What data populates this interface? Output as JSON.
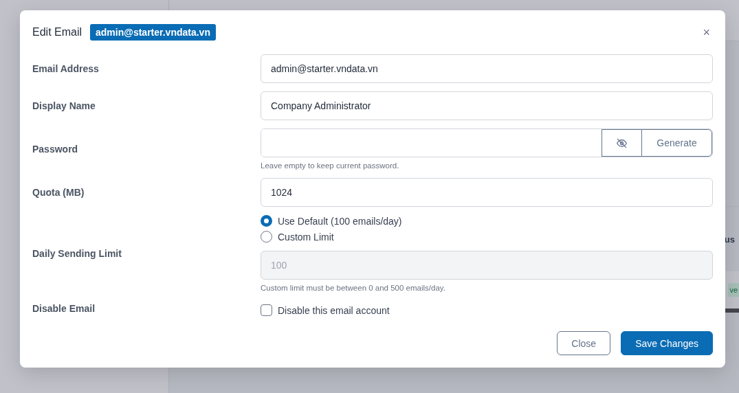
{
  "backdrop": {
    "column_header": "us",
    "status_badge": "ve"
  },
  "dialog": {
    "title": "Edit Email",
    "badge": "admin@starter.vndata.vn",
    "close": "×",
    "fields": [
      {
        "kind": "text",
        "label": "Email Address",
        "value": "admin@starter.vndata.vn"
      },
      {
        "kind": "text",
        "label": "Display Name",
        "value": "Company Administrator"
      },
      {
        "kind": "password",
        "label": "Password",
        "generate": "Generate",
        "hint": "Leave empty to keep current password."
      },
      {
        "kind": "text",
        "label": "Quota (MB)",
        "value": "1024"
      },
      {
        "kind": "limit",
        "label": "Daily Sending Limit",
        "options": [
          {
            "label": "Use Default (100 emails/day)",
            "selected": true
          },
          {
            "label": "Custom Limit",
            "selected": false
          }
        ],
        "placeholder": "100",
        "disabled": true,
        "hint": "Custom limit must be between 0 and 500 emails/day."
      },
      {
        "kind": "checkbox",
        "label": "Disable Email",
        "text": "Disable this email account",
        "checked": false
      }
    ],
    "buttons": [
      {
        "label": "Close",
        "kind": "secondary"
      },
      {
        "label": "Save Changes",
        "kind": "primary"
      }
    ]
  }
}
